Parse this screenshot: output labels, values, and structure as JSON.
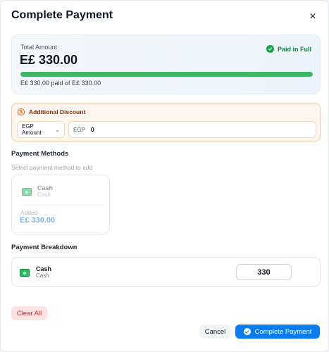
{
  "modal": {
    "title": "Complete Payment",
    "close_label": "×"
  },
  "total": {
    "label": "Total Amount",
    "amount": "E£ 330.00",
    "status": "Paid in Full",
    "status_color": "#15803d",
    "progress_fraction": 1.0,
    "progress_text": "E£ 330.00 paid of E£ 330.00"
  },
  "discount": {
    "title": "Additional Discount",
    "type_selected": "EGP Amount",
    "prefix": "EGP",
    "value": "0"
  },
  "payment_methods": {
    "title": "Payment Methods",
    "subtitle": "Select payment method to add",
    "items": [
      {
        "name": "Cash",
        "subtitle": "Cash",
        "added_label": "Added",
        "added_amount": "E£ 330.00",
        "icon": "cash-icon"
      }
    ]
  },
  "breakdown": {
    "title": "Payment Breakdown",
    "items": [
      {
        "name": "Cash",
        "subtitle": "Cash",
        "amount": "330",
        "icon": "cash-icon"
      }
    ]
  },
  "actions": {
    "clear_label": "Clear All",
    "cancel_label": "Cancel",
    "complete_label": "Complete Payment",
    "primary_color": "#0a7cf0",
    "danger_color": "#dc2626"
  }
}
